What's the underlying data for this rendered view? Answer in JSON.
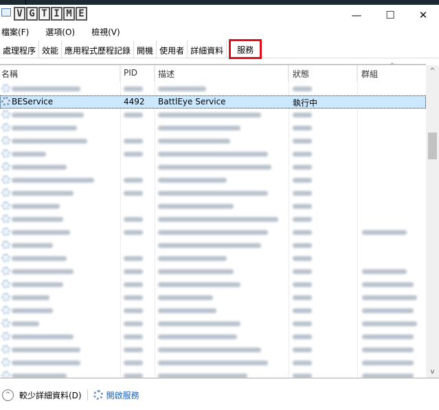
{
  "window": {
    "logo_text": "VGTIME",
    "minimize": "—",
    "maximize": "☐",
    "close": "✕"
  },
  "menu": [
    "檔案(F)",
    "選項(O)",
    "檢視(V)"
  ],
  "tabs": [
    "處理程序",
    "效能",
    "應用程式歷程記錄",
    "開機",
    "使用者",
    "詳細資料",
    "服務"
  ],
  "active_tab": "服務",
  "columns": {
    "name": "名稱",
    "pid": "PID",
    "desc": "描述",
    "status": "狀態",
    "group": "群組"
  },
  "selected_row": {
    "name": "BEService",
    "pid": "4492",
    "desc": "BattlEye Service",
    "status": "執行中",
    "group": ""
  },
  "footer": {
    "fewer_details": "較少詳細資料(D)",
    "open_services": "開啟服務"
  },
  "colors": {
    "highlight": "#e0101b",
    "selection": "#cce8ff",
    "link": "#1a5fb4"
  }
}
